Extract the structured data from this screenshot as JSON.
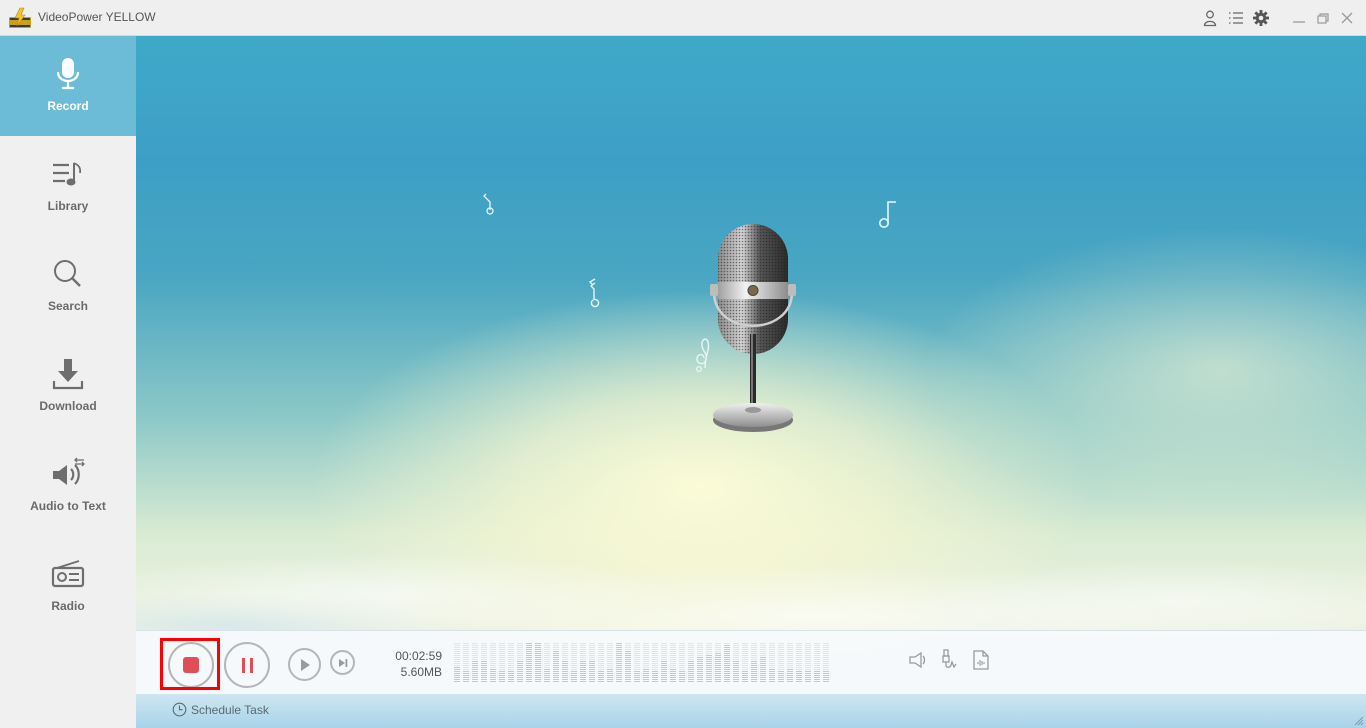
{
  "app": {
    "title": "VideoPower YELLOW",
    "window_controls": [
      "user-icon",
      "menu-list-icon",
      "settings-gear-icon",
      "minimize-icon",
      "restore-icon",
      "close-icon"
    ]
  },
  "sidebar": {
    "items": [
      {
        "label": "Record",
        "icon": "microphone-icon",
        "active": true
      },
      {
        "label": "Library",
        "icon": "music-library-icon",
        "active": false
      },
      {
        "label": "Search",
        "icon": "search-icon",
        "active": false
      },
      {
        "label": "Download",
        "icon": "download-icon",
        "active": false
      },
      {
        "label": "Audio to Text",
        "icon": "speaker-convert-icon",
        "active": false
      },
      {
        "label": "Radio",
        "icon": "radio-icon",
        "active": false
      }
    ]
  },
  "recorder": {
    "elapsed_time": "00:02:59",
    "file_size": "5.60MB",
    "state": "recording",
    "controls": [
      "stop",
      "pause",
      "play",
      "next"
    ],
    "right_icons": [
      "system-sound-icon",
      "microphone-input-icon",
      "audio-file-icon"
    ],
    "level_meter": [
      0.4,
      0.3,
      0.55,
      0.55,
      0.35,
      0.3,
      0.3,
      0.55,
      1.0,
      1.0,
      0.35,
      0.8,
      0.55,
      0.3,
      0.55,
      0.55,
      0.3,
      0.35,
      1.0,
      0.8,
      0.3,
      0.35,
      0.3,
      0.55,
      0.35,
      0.3,
      0.55,
      0.65,
      0.7,
      0.75,
      0.95,
      0.55,
      0.3,
      0.55,
      0.65,
      0.35,
      0.3,
      0.35,
      0.3,
      0.3,
      0.3,
      0.3
    ]
  },
  "colors": {
    "active_nav_bg": "#6dbcd7",
    "record_red": "#e04e58",
    "highlight_red": "#ff0000"
  },
  "footer": {
    "schedule_label": "Schedule Task"
  }
}
